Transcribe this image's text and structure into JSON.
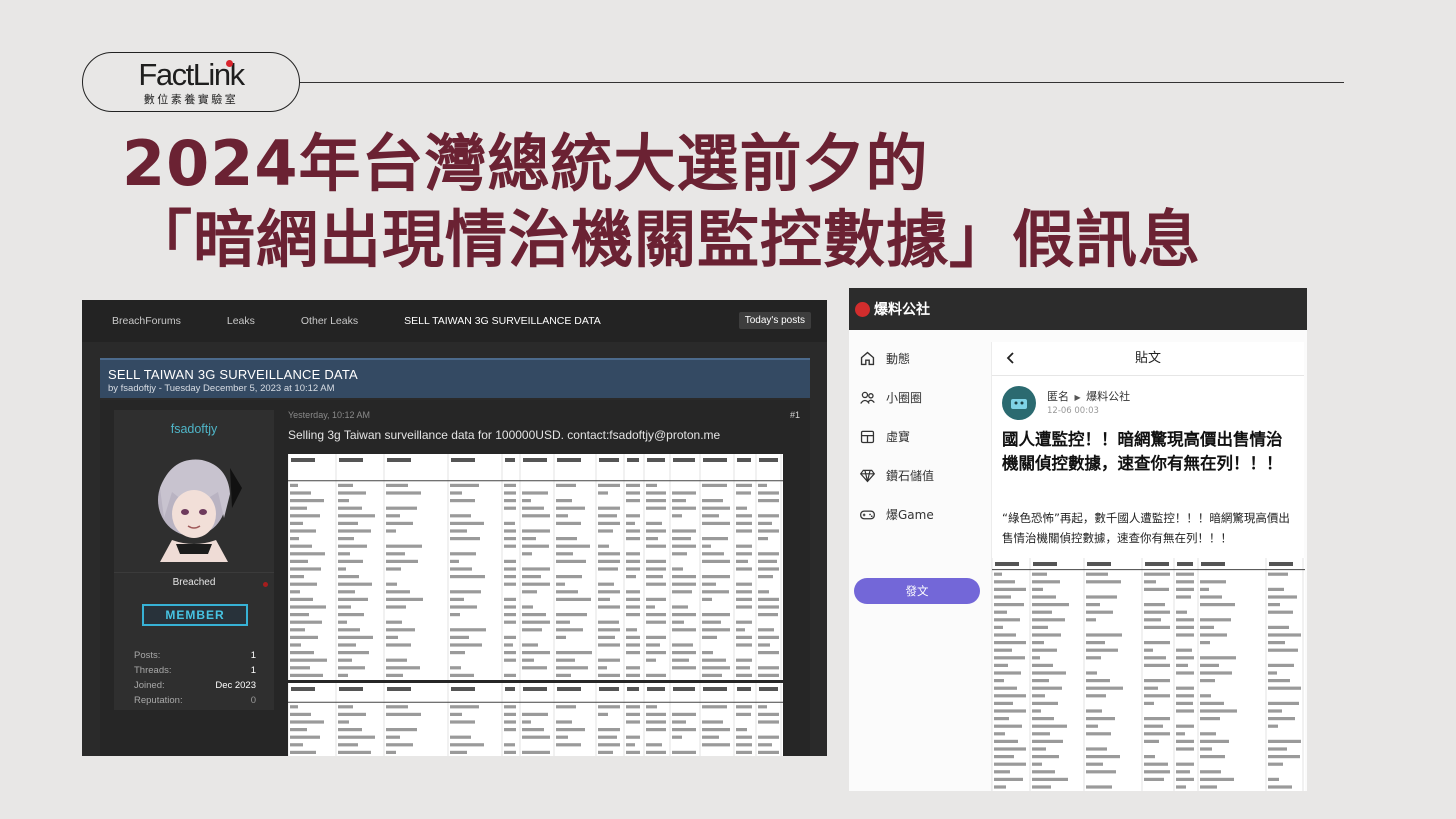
{
  "logo": {
    "name": "FactLink",
    "subtitle": "數位素養實驗室"
  },
  "headline": {
    "line1": "2024年台灣總統大選前夕的",
    "line2": "「暗網出現情治機關監控數據」假訊息"
  },
  "breachforums": {
    "nav": [
      "BreachForums",
      "Leaks",
      "Other Leaks",
      "SELL TAIWAN 3G SURVEILLANCE DATA"
    ],
    "todays_posts": "Today's posts",
    "thread_title": "SELL TAIWAN 3G SURVEILLANCE DATA",
    "thread_meta": "by fsadoftjy - Tuesday December 5, 2023 at 10:12 AM",
    "username": "fsadoftjy",
    "status": "Breached",
    "badge": "MEMBER",
    "stats": [
      {
        "label": "Posts:",
        "value": "1"
      },
      {
        "label": "Threads:",
        "value": "1"
      },
      {
        "label": "Joined:",
        "value": "Dec 2023"
      },
      {
        "label": "Reputation:",
        "value": "0"
      }
    ],
    "post_date": "Yesterday, 10:12 AM",
    "post_number": "#1",
    "post_text": "Selling 3g Taiwan surveillance data for 100000USD. contact:fsadoftjy@proton.me",
    "colors": {
      "bar": "#344a63",
      "accent": "#4fb5c7"
    }
  },
  "baoliao": {
    "brand": "爆料公社",
    "sidebar": [
      {
        "label": "動態",
        "icon": "home-icon"
      },
      {
        "label": "小圈圈",
        "icon": "group-icon"
      },
      {
        "label": "虛寶",
        "icon": "treasure-icon"
      },
      {
        "label": "鑽石儲值",
        "icon": "diamond-icon"
      },
      {
        "label": "爆Game",
        "icon": "gamepad-icon"
      }
    ],
    "post_button": "發文",
    "panel_title": "貼文",
    "author": "匿名",
    "group": "爆料公社",
    "time": "12-06 00:03",
    "title": "國人遭監控！！暗網驚現高價出售情治機關偵控數據，速查你有無在列！！！",
    "body": "“綠色恐怖”再起，數千國人遭監控！！！暗網驚現高價出售情治機關偵控數據，速查你有無在列！！！",
    "colors": {
      "post_button": "#7367d8",
      "topbar": "#2c2c2c"
    }
  }
}
